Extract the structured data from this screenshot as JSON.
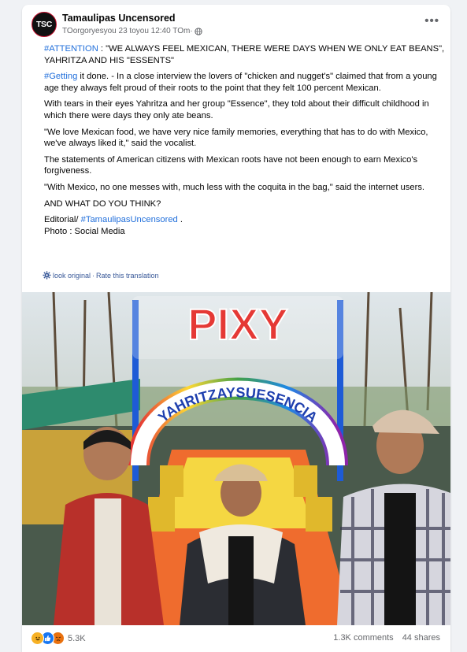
{
  "post": {
    "page_name": "Tamaulipas Uncensored",
    "avatar_text": "TSC",
    "meta": "TOorgoryesyou 23 toyou 12:40 TOm·",
    "privacy_icon": "globe-icon",
    "more_label": "•••"
  },
  "body": {
    "p1_tag": "#ATTENTION",
    "p1_text": " : \"WE ALWAYS FEEL MEXICAN, THERE WERE DAYS WHEN WE ONLY EAT BEANS\", YAHRITZA AND HIS \"ESSENTS\"",
    "p2_tag": "#Getting",
    "p2_text": " it done. - In a close interview the lovers of \"chicken and nugget's\" claimed that from a young age they always felt proud of their roots to the point that they felt 100 percent Mexican.",
    "p3": "With tears in their eyes Yahritza and her group \"Essence\", they told about their difficult childhood in which there were days they only ate beans.",
    "p4": "\"We love Mexican food, we have very nice family memories, everything that has to do with Mexico, we've always liked it,\" said the vocalist.",
    "p5": "The statements of American citizens with Mexican roots have not been enough to earn Mexico's forgiveness.",
    "p6": "\"With Mexico, no one messes with, much less with the coquita in the bag,\" said the internet users.",
    "p7": "AND WHAT DO YOU THINK?",
    "p8_prefix": "Editorial/ ",
    "p8_tag": "#TamaulipasUncensored",
    "p8_suffix": " .",
    "p9": "Photo : Social Media"
  },
  "translation": {
    "icon": "gear-icon",
    "see_original": "look original",
    "separator": "·",
    "rate": "Rate this translation"
  },
  "photo": {
    "arch_top": "PIXY",
    "arch_sign": "YAHRITZAYSUESENCIA"
  },
  "footer": {
    "reaction_icons": [
      "haha-icon",
      "like-icon",
      "angry-icon"
    ],
    "reaction_count": "5.3K",
    "comments": "1.3K comments",
    "shares": "44 shares"
  },
  "colors": {
    "hashtag": "#216fdb",
    "secondary_text": "#65676b",
    "link": "#385898"
  }
}
